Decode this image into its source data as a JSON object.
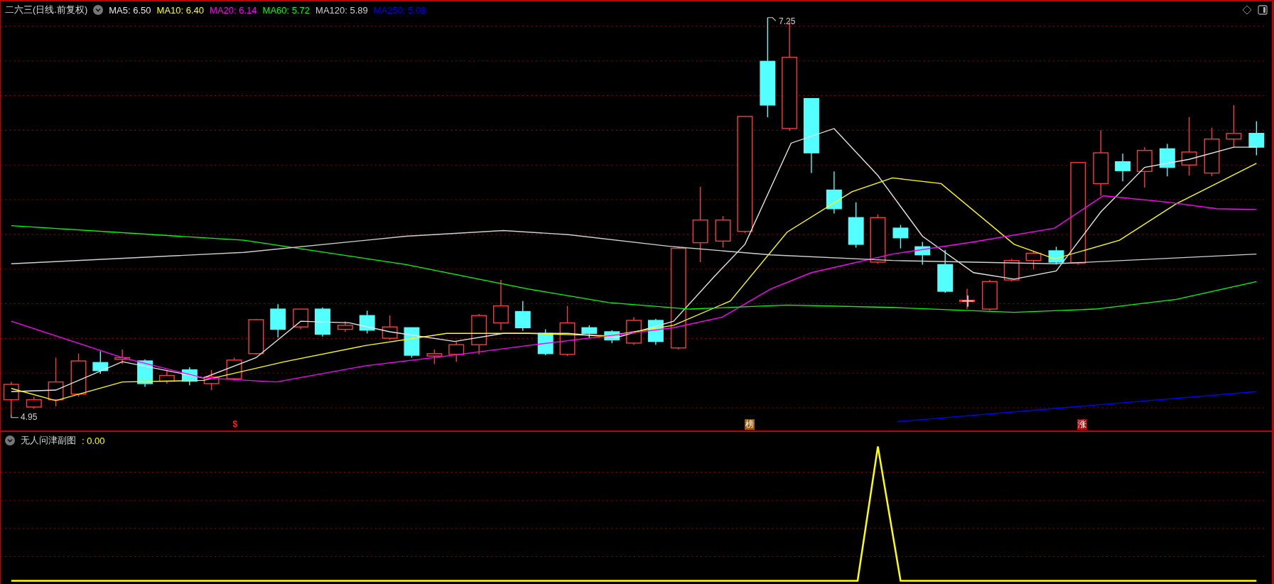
{
  "chart": {
    "title": "二六三(日线.前复权)",
    "moving_averages": [
      {
        "label": "MA5: 6.50",
        "color": "#e6e6e6"
      },
      {
        "label": "MA10: 6.40",
        "color": "#ffff00"
      },
      {
        "label": "MA20: 6.14",
        "color": "#ff00ff"
      },
      {
        "label": "MA60: 5.72",
        "color": "#00ff00"
      },
      {
        "label": "MA120: 5.89",
        "color": "#d0d0d0"
      },
      {
        "label": "MA250: 5.08",
        "color": "#0000ff"
      }
    ],
    "high_label": "7.25",
    "low_label": "4.95",
    "signals": [
      {
        "text": "$",
        "kind": "symbol"
      },
      {
        "text": "榜",
        "kind": "rank"
      },
      {
        "text": "涨",
        "kind": "rise"
      }
    ]
  },
  "sub_chart": {
    "title": "无人问津副图",
    "value": ": 0.00"
  }
}
